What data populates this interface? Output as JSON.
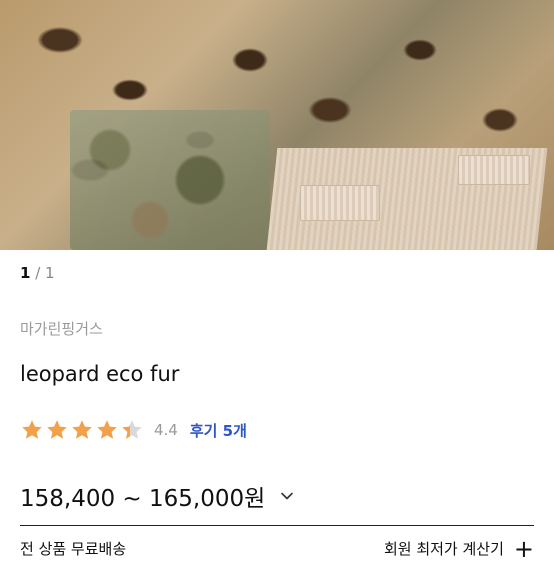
{
  "product_image": {
    "alt_icon": "product-photo"
  },
  "pager": {
    "current": "1",
    "separator": " / ",
    "total": "1"
  },
  "brand": "마가린핑거스",
  "title": "leopard eco fur",
  "rating": {
    "stars": 4.4,
    "score": "4.4",
    "reviews_label": "후기 5개",
    "star_color": "#f2a04a",
    "star_empty_color": "#d9d9d9"
  },
  "price": {
    "range": "158,400 ~ 165,000원"
  },
  "shipping": {
    "label": "전 상품 무료배송"
  },
  "calc": {
    "label": "회원 최저가 계산기",
    "icon": "plus-icon"
  },
  "colors": {
    "accent_link": "#2f56c9"
  }
}
